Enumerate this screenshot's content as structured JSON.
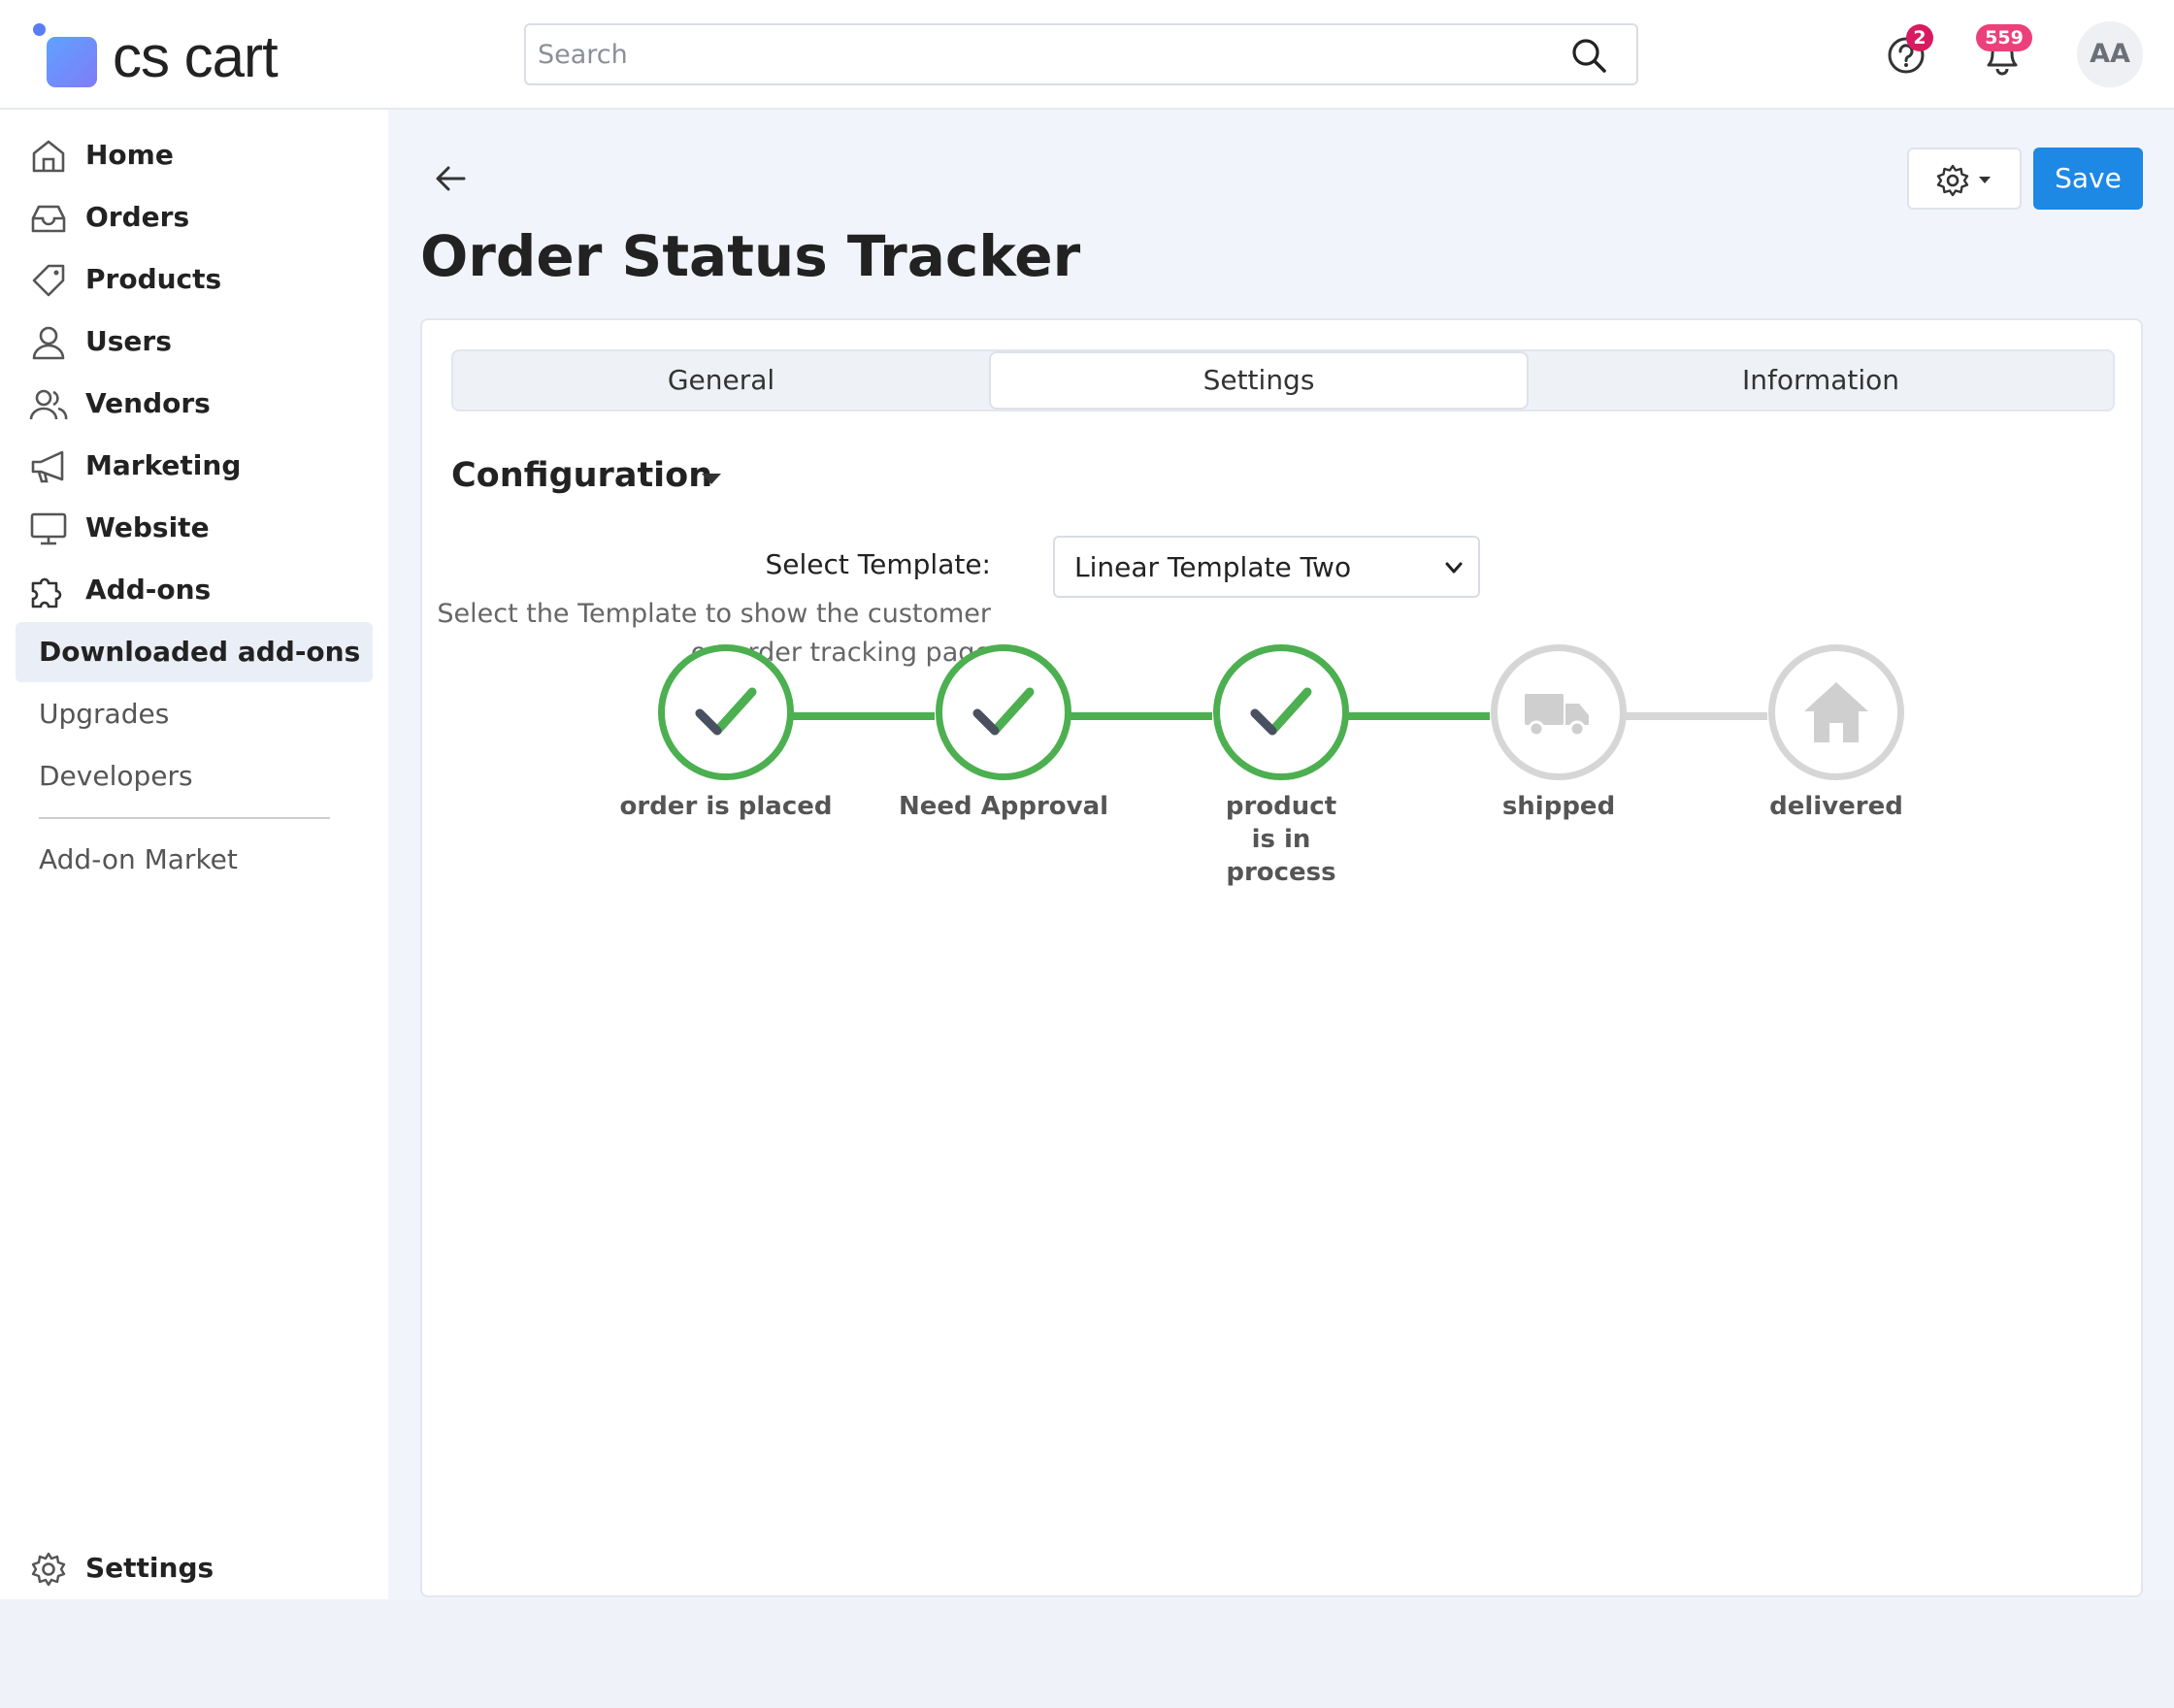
{
  "app": {
    "logo_text": "cs cart"
  },
  "header": {
    "search_placeholder": "Search",
    "help_badge": "2",
    "notifications_badge": "559",
    "avatar_initials": "AA"
  },
  "sidebar": {
    "items": [
      {
        "label": "Home",
        "icon": "home-icon"
      },
      {
        "label": "Orders",
        "icon": "inbox-icon"
      },
      {
        "label": "Products",
        "icon": "tag-icon"
      },
      {
        "label": "Users",
        "icon": "user-icon"
      },
      {
        "label": "Vendors",
        "icon": "users-icon"
      },
      {
        "label": "Marketing",
        "icon": "megaphone-icon"
      },
      {
        "label": "Website",
        "icon": "monitor-icon"
      },
      {
        "label": "Add-ons",
        "icon": "puzzle-icon"
      }
    ],
    "subitems": [
      {
        "label": "Downloaded add-ons",
        "active": true
      },
      {
        "label": "Upgrades",
        "active": false
      },
      {
        "label": "Developers",
        "active": false
      }
    ],
    "market_label": "Add-on Market",
    "settings_label": "Settings"
  },
  "page": {
    "title": "Order Status Tracker",
    "save_label": "Save"
  },
  "tabs": [
    {
      "label": "General",
      "active": false
    },
    {
      "label": "Settings",
      "active": true
    },
    {
      "label": "Information",
      "active": false
    }
  ],
  "configuration": {
    "title": "Configuration",
    "select_label": "Select Template:",
    "select_help": "Select the Template to show the customer on order tracking page",
    "select_value": "Linear Template Two"
  },
  "tracker": {
    "steps": [
      {
        "label": "order is placed",
        "done": true,
        "icon": "check-icon"
      },
      {
        "label": "Need Approval",
        "done": true,
        "icon": "check-icon"
      },
      {
        "label": "product is in process",
        "done": true,
        "icon": "check-icon"
      },
      {
        "label": "shipped",
        "done": false,
        "icon": "truck-icon"
      },
      {
        "label": "delivered",
        "done": false,
        "icon": "house-icon"
      }
    ]
  },
  "colors": {
    "accent": "#1e88e5",
    "done": "#4caf50",
    "pending": "#d6d6d6",
    "help_badge": "#d81b60",
    "notif_badge": "#ec407a"
  }
}
